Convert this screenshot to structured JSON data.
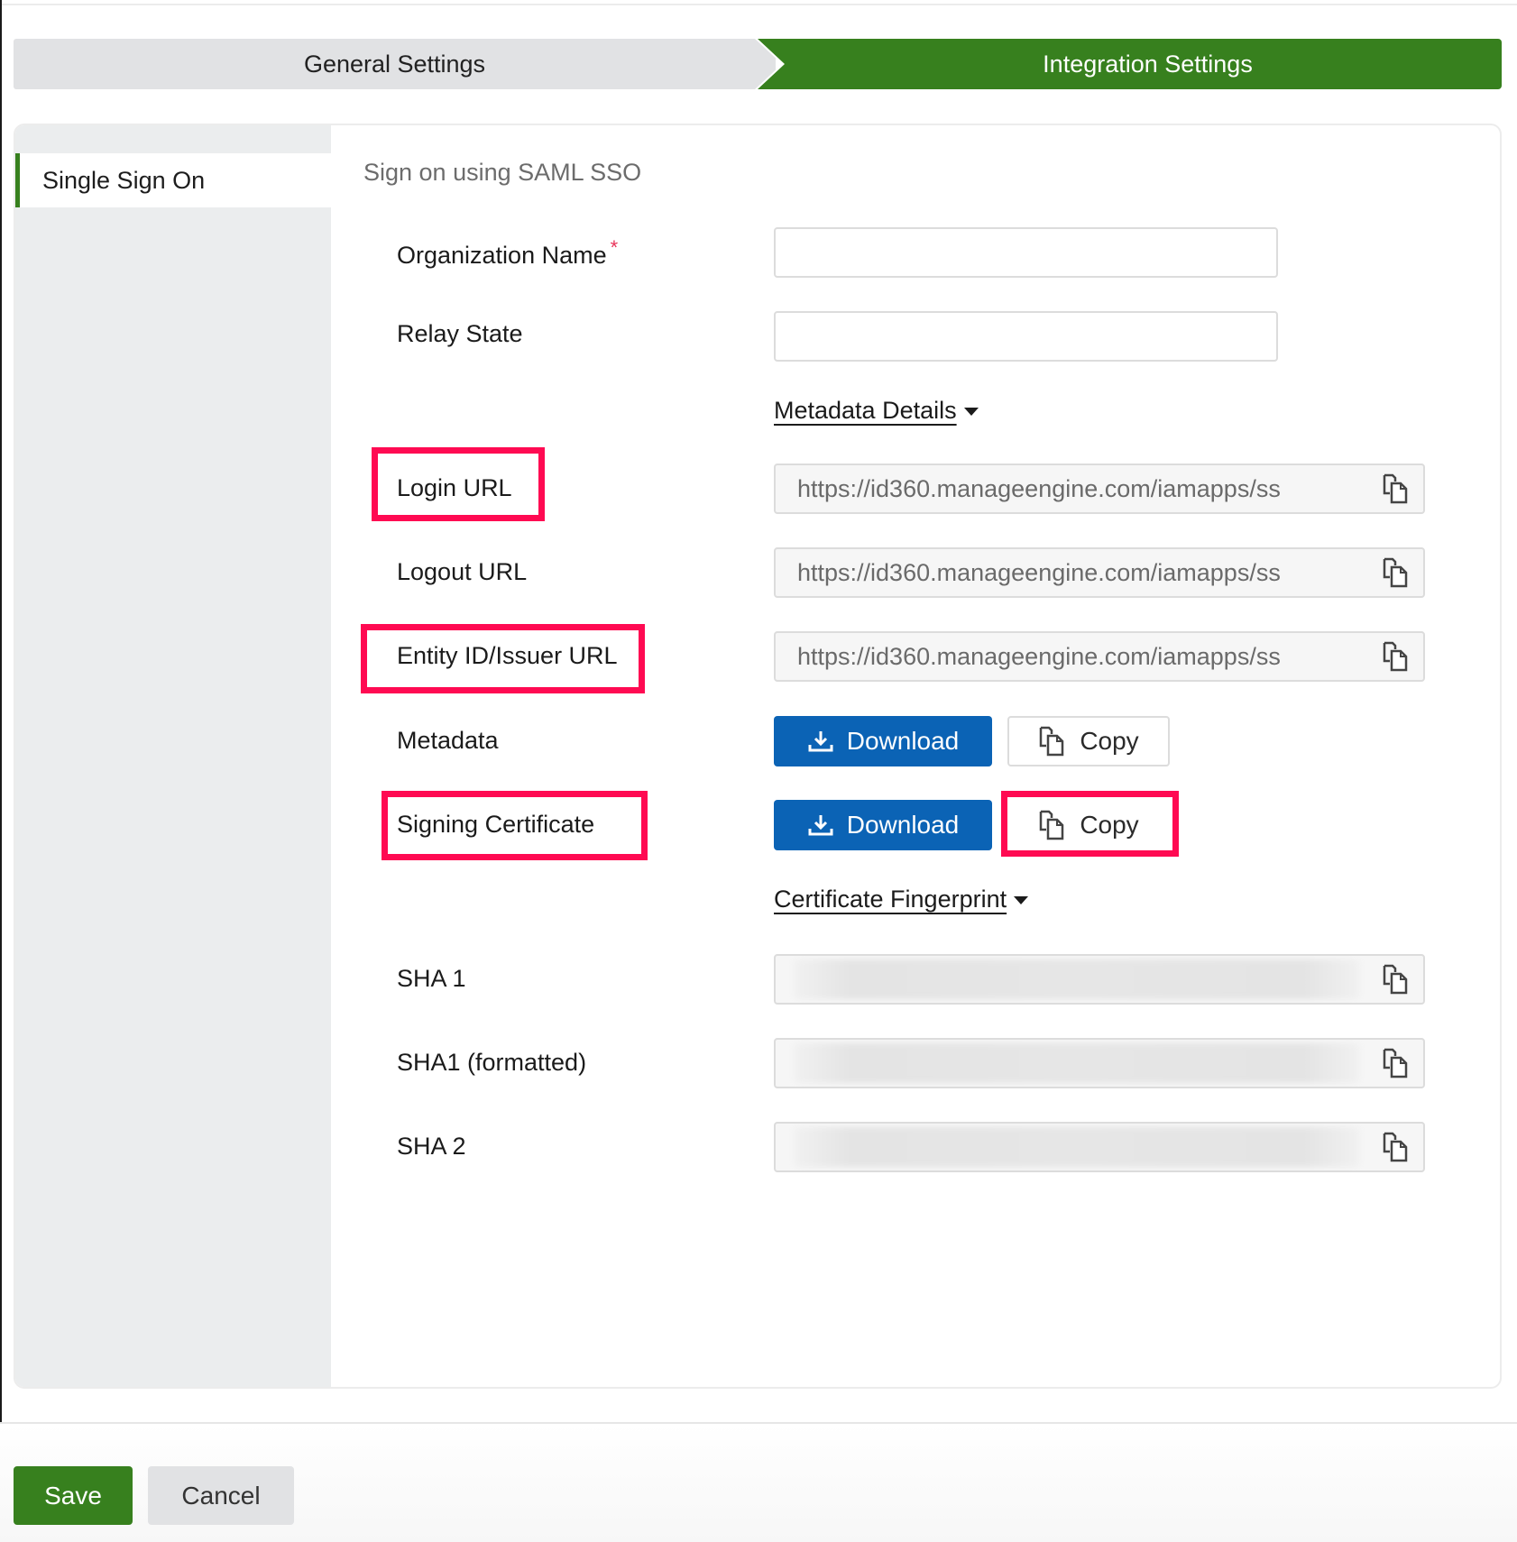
{
  "steps": {
    "general": "General Settings",
    "integration": "Integration Settings"
  },
  "sidebar": {
    "items": [
      {
        "label": "Single Sign On",
        "active": true
      }
    ]
  },
  "section": {
    "title": "Sign on using SAML SSO"
  },
  "form": {
    "organization_name": {
      "label": "Organization Name",
      "required_mark": "*",
      "value": ""
    },
    "relay_state": {
      "label": "Relay State",
      "value": ""
    },
    "metadata_details_toggle": "Metadata Details",
    "login_url": {
      "label": "Login URL",
      "value": "https://id360.manageengine.com/iamapps/ss"
    },
    "logout_url": {
      "label": "Logout URL",
      "value": "https://id360.manageengine.com/iamapps/ss"
    },
    "entity_id": {
      "label": "Entity ID/Issuer URL",
      "value": "https://id360.manageengine.com/iamapps/ss"
    },
    "metadata": {
      "label": "Metadata",
      "download_label": "Download",
      "copy_label": "Copy"
    },
    "signing_certificate": {
      "label": "Signing Certificate",
      "download_label": "Download",
      "copy_label": "Copy"
    },
    "certificate_fingerprint_toggle": "Certificate Fingerprint",
    "sha1": {
      "label": "SHA 1",
      "value_state": "blurred"
    },
    "sha1_formatted": {
      "label": "SHA1 (formatted)",
      "value_state": "blurred"
    },
    "sha2": {
      "label": "SHA 2",
      "value_state": "blurred"
    }
  },
  "footer": {
    "save_label": "Save",
    "cancel_label": "Cancel"
  },
  "colors": {
    "brand_green": "#37801e",
    "download_blue": "#0b63b5",
    "highlight_pink": "#ff0a52",
    "required_red": "#e8345a"
  },
  "annotations": {
    "highlighted": [
      "Login URL",
      "Entity ID/Issuer URL",
      "Signing Certificate",
      "Signing Certificate Copy"
    ]
  }
}
